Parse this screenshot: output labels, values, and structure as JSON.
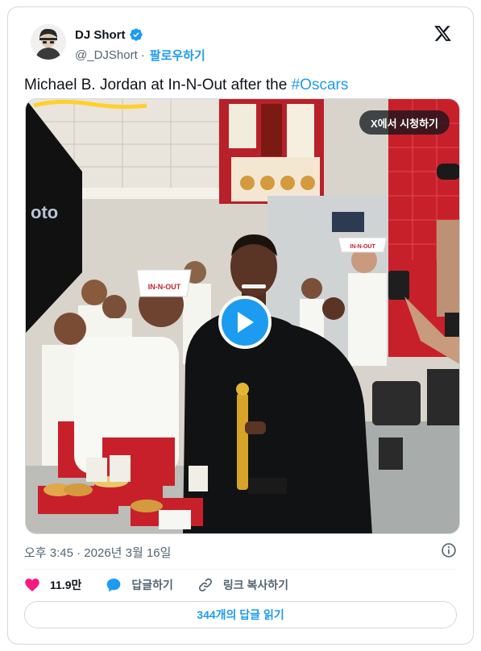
{
  "user": {
    "display_name": "DJ Short",
    "handle": "@_DJShort",
    "separator": "·",
    "follow_label": "팔로우하기"
  },
  "tweet": {
    "text": "Michael B. Jordan at In-N-Out after the ",
    "hashtag": "#Oscars"
  },
  "media": {
    "watch_on_x_label": "X에서 시청하기",
    "scene_text": {
      "outside_sign": "oto",
      "cashier_hat": "IN-N-OUT",
      "hat_logo": "IN-N-OUT"
    }
  },
  "timestamp": "오후 3:45 · 2026년 3월 16일",
  "actions": {
    "likes_count": "11.9만",
    "reply_label": "답글하기",
    "copy_link_label": "링크 복사하기"
  },
  "read_replies_label": "344개의 답글 읽기",
  "colors": {
    "accent": "#1d9bf0",
    "like": "#f91880",
    "text_secondary": "#536471"
  },
  "icons": {
    "verified": "verified-badge-icon",
    "x_logo": "x-logo-icon",
    "play": "play-icon",
    "info": "info-icon",
    "heart": "heart-icon",
    "reply": "reply-bubble-icon",
    "link": "link-icon"
  }
}
